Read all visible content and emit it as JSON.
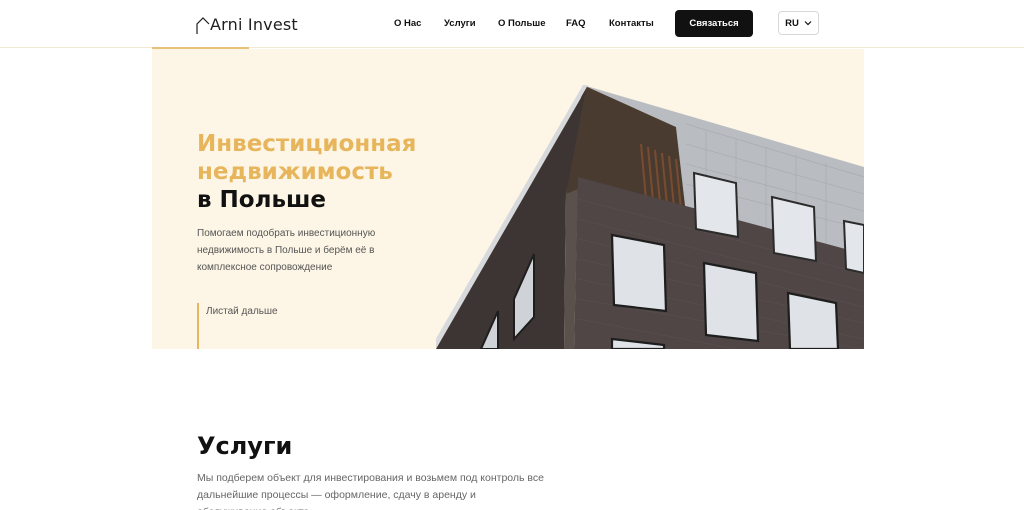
{
  "header": {
    "logo_text": "Arni Invest",
    "nav": [
      {
        "label": "О Нас"
      },
      {
        "label": "Услуги"
      },
      {
        "label": "О Польше"
      },
      {
        "label": "FAQ"
      },
      {
        "label": "Контакты"
      }
    ],
    "contact_button": "Связаться",
    "language": "RU"
  },
  "hero": {
    "title_line1": "Инвестиционная",
    "title_line2": "недвижимость",
    "title_line3": "в Польше",
    "description": "Помогаем подобрать инвестиционную недвижимость в Польше и берём её в комплексное сопровождение",
    "scroll_label": "Листай дальше"
  },
  "services": {
    "title": "Услуги",
    "description": "Мы подберем объект для инвестирования и возьмем под контроль все дальнейшие процессы — оформление, сдачу в аренду и обслуживание объекта"
  },
  "colors": {
    "accent": "#e7b65c",
    "hero_bg": "#fdf6e6",
    "button_bg": "#111111"
  }
}
